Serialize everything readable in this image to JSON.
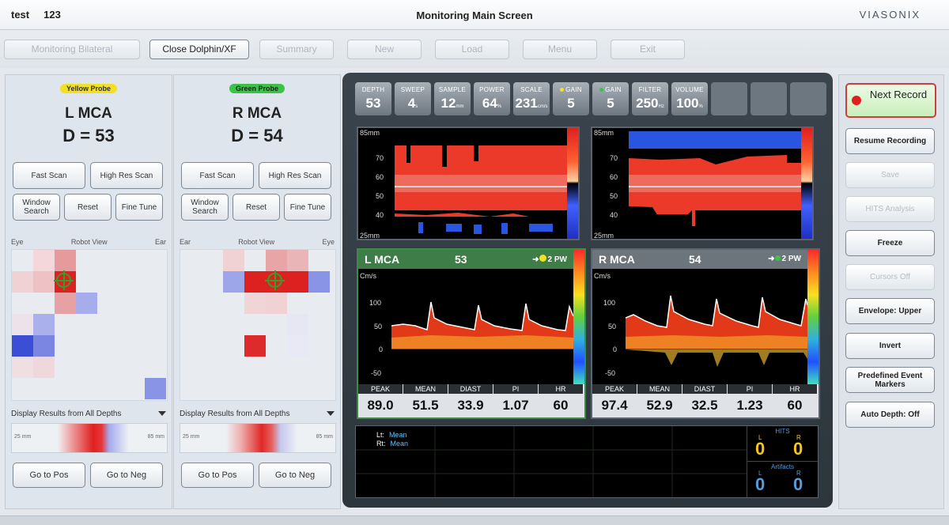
{
  "titlebar": {
    "patient": "test     123",
    "screen_title": "Monitoring Main Screen",
    "brand": "VIASONIX"
  },
  "toolbar": {
    "monitoring_bilateral": "Monitoring Bilateral",
    "close_dolphin": "Close Dolphin/XF",
    "summary": "Summary",
    "new": "New",
    "load": "Load",
    "menu": "Menu",
    "exit": "Exit"
  },
  "left_probe": {
    "tag": "Yellow Probe",
    "vessel": "L MCA",
    "depth": "D = 53",
    "fast_scan": "Fast Scan",
    "high_res_scan": "High Res Scan",
    "window_search": "Window Search",
    "reset": "Reset",
    "fine_tune": "Fine Tune",
    "robot_left": "Eye",
    "robot_center": "Robot View",
    "robot_right": "Ear",
    "display_results": "Display Results from All Depths",
    "depth_min": "25 mm",
    "depth_max": "85 mm",
    "go_to_pos": "Go to Pos",
    "go_to_neg": "Go to Neg"
  },
  "right_probe": {
    "tag": "Green Probe",
    "vessel": "R MCA",
    "depth": "D = 54",
    "fast_scan": "Fast Scan",
    "high_res_scan": "High Res Scan",
    "window_search": "Window Search",
    "reset": "Reset",
    "fine_tune": "Fine Tune",
    "robot_left": "Ear",
    "robot_center": "Robot View",
    "robot_right": "Eye",
    "display_results": "Display Results from All Depths",
    "depth_min": "25 mm",
    "depth_max": "85 mm",
    "go_to_pos": "Go to Pos",
    "go_to_neg": "Go to Neg"
  },
  "params": [
    {
      "label": "DEPTH",
      "value": "53",
      "unit": ""
    },
    {
      "label": "SWEEP",
      "value": "4",
      "unit": "s"
    },
    {
      "label": "SAMPLE",
      "value": "12",
      "unit": "mm"
    },
    {
      "label": "POWER",
      "value": "64",
      "unit": "%"
    },
    {
      "label": "SCALE",
      "value": "231",
      "unit": "cm/s"
    },
    {
      "label": "GAIN",
      "value": "5",
      "unit": "",
      "dot": "#f2e024"
    },
    {
      "label": "GAIN",
      "value": "5",
      "unit": "",
      "dot": "#3cc24a"
    },
    {
      "label": "FILTER",
      "value": "250",
      "unit": "Hz"
    },
    {
      "label": "VOLUME",
      "value": "100",
      "unit": "%"
    }
  ],
  "mmode": {
    "top_label": "85mm",
    "bottom_label": "25mm",
    "ticks": [
      "70",
      "60",
      "50",
      "40"
    ]
  },
  "spectrum_left": {
    "vessel": "L MCA",
    "depth": "53",
    "mode": "2 PW",
    "unit": "Cm/s",
    "ticks": [
      "100",
      "50",
      "0",
      "-50"
    ],
    "stat_labels": [
      "PEAK",
      "MEAN",
      "DIAST",
      "PI",
      "HR"
    ],
    "stat_values": [
      "89.0",
      "51.5",
      "33.9",
      "1.07",
      "60"
    ]
  },
  "spectrum_right": {
    "vessel": "R MCA",
    "depth": "54",
    "mode": "2 PW",
    "unit": "Cm/s",
    "ticks": [
      "100",
      "50",
      "0",
      "-50"
    ],
    "stat_labels": [
      "PEAK",
      "MEAN",
      "DIAST",
      "PI",
      "HR"
    ],
    "stat_values": [
      "97.4",
      "52.9",
      "32.5",
      "1.23",
      "60"
    ]
  },
  "trend": {
    "lt_label": "Lt:",
    "lt_value": "Mean",
    "rt_label": "Rt:",
    "rt_value": "Mean",
    "hits_label": "HITS",
    "hits_l": "L",
    "hits_r": "R",
    "hits_l_value": "0",
    "hits_r_value": "0",
    "artifacts_label": "Artifacts",
    "art_l": "L",
    "art_r": "R",
    "art_l_value": "0",
    "art_r_value": "0"
  },
  "actions": {
    "next_record": "Next Record",
    "resume_recording": "Resume Recording",
    "save": "Save",
    "hits_analysis": "HITS Analysis",
    "freeze": "Freeze",
    "cursors_off": "Cursors Off",
    "envelope_upper": "Envelope: Upper",
    "invert": "Invert",
    "predefined_event_markers": "Predefined Event Markers",
    "auto_depth_off": "Auto Depth: Off"
  },
  "colors": {
    "accent_red": "#e21f1f",
    "green_probe": "#3cc24a",
    "yellow_probe": "#f2e024",
    "trend_blue": "#5dc0ff"
  }
}
